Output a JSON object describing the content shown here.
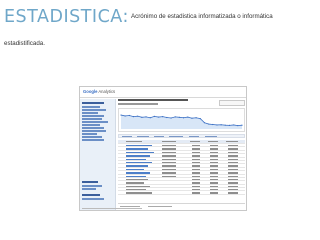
{
  "slide": {
    "title": "ESTADISTICA:",
    "line1": "Acrónimo de estadistica informatizada o informática",
    "line2": "estadistificada."
  },
  "screenshot": {
    "logo_brand": "Google",
    "logo_product": "Analytics"
  },
  "chart_data": {
    "type": "line",
    "title": "",
    "x": [
      1,
      2,
      3,
      4,
      5,
      6,
      7,
      8,
      9,
      10,
      11,
      12,
      13,
      14,
      15,
      16,
      17,
      18,
      19,
      20,
      21,
      22,
      23,
      24,
      25,
      26,
      27,
      28,
      29,
      30
    ],
    "series": [
      {
        "values": [
          62,
          58,
          60,
          55,
          57,
          52,
          54,
          50,
          56,
          53,
          55,
          51,
          49,
          54,
          52,
          50,
          53,
          48,
          50,
          46,
          28,
          22,
          20,
          18,
          19,
          17,
          16,
          18,
          15,
          17
        ]
      }
    ],
    "ylim": [
      0,
      80
    ],
    "grid": false
  },
  "colors": {
    "title": "#6fa7c9",
    "line": "#3a6fc4",
    "area": "#d8e6f7"
  }
}
